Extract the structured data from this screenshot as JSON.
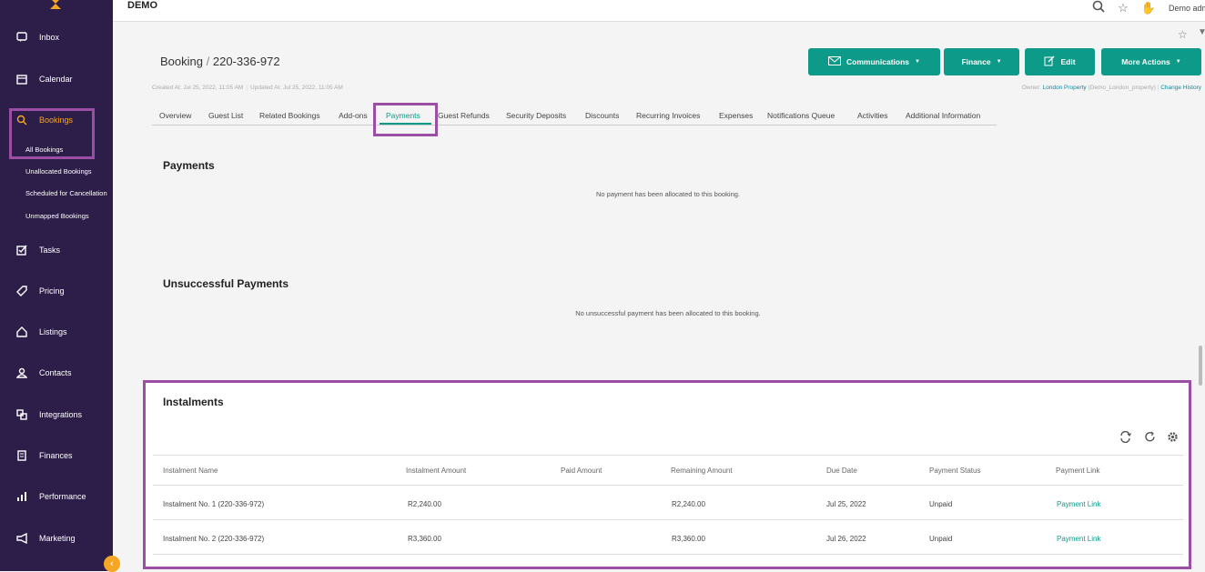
{
  "topbar": {
    "brand": "DEMO",
    "user": "Demo admin"
  },
  "sidebar": {
    "items": [
      {
        "label": "Inbox"
      },
      {
        "label": "Calendar"
      },
      {
        "label": "Bookings"
      },
      {
        "label": "Tasks"
      },
      {
        "label": "Pricing"
      },
      {
        "label": "Listings"
      },
      {
        "label": "Contacts"
      },
      {
        "label": "Integrations"
      },
      {
        "label": "Finances"
      },
      {
        "label": "Performance"
      },
      {
        "label": "Marketing"
      }
    ],
    "sub_items": [
      {
        "label": "All Bookings"
      },
      {
        "label": "Unallocated Bookings"
      },
      {
        "label": "Scheduled for Cancellation"
      },
      {
        "label": "Unmapped Bookings"
      }
    ]
  },
  "header": {
    "breadcrumb_root": "Booking",
    "separator": "/",
    "booking_id": "220-336-972",
    "created": "Created At: Jul 25, 2022, 11:05 AM",
    "updated": "Updated At: Jul 25, 2022, 11:05 AM",
    "owner_prefix": "Owner:",
    "owner_name": "London Property",
    "owner_code": "(Demo_London_property)",
    "change_history": "Change History"
  },
  "actions": {
    "communications": "Communications",
    "finance": "Finance",
    "edit": "Edit",
    "more_actions": "More Actions"
  },
  "tabs": [
    "Overview",
    "Guest List",
    "Related Bookings",
    "Add-ons",
    "Payments",
    "Guest Refunds",
    "Security Deposits",
    "Discounts",
    "Recurring Invoices",
    "Expenses",
    "Notifications Queue",
    "Activities",
    "Additional Information"
  ],
  "payments": {
    "title": "Payments",
    "empty": "No payment has been allocated to this booking."
  },
  "unsuccessful": {
    "title": "Unsuccessful Payments",
    "empty": "No unsuccessful payment has been allocated to this booking."
  },
  "instalments": {
    "title": "Instalments",
    "columns": [
      "Instalment Name",
      "Instalment Amount",
      "Paid Amount",
      "Remaining Amount",
      "Due Date",
      "Payment Status",
      "Payment Link"
    ],
    "rows": [
      {
        "name": "Instalment No. 1 (220-336-972)",
        "amount": "R2,240.00",
        "paid": "",
        "remaining": "R2,240.00",
        "due": "Jul 25, 2022",
        "status": "Unpaid",
        "link": "Payment Link"
      },
      {
        "name": "Instalment No. 2 (220-336-972)",
        "amount": "R3,360.00",
        "paid": "",
        "remaining": "R3,360.00",
        "due": "Jul 26, 2022",
        "status": "Unpaid",
        "link": "Payment Link"
      }
    ]
  },
  "colors": {
    "accent": "#0e9a88",
    "sidebar": "#2d1d49",
    "highlight": "#9b4fa4",
    "orange": "#f5a623"
  }
}
